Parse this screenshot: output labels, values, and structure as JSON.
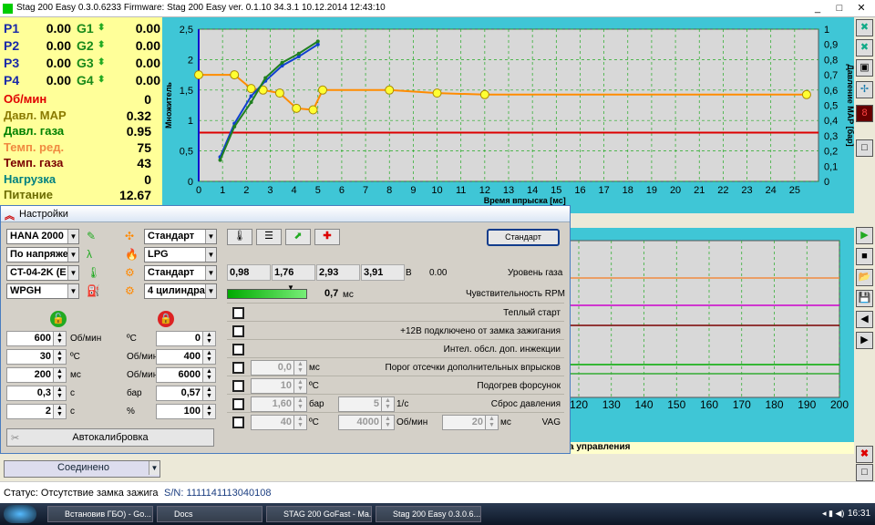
{
  "window": {
    "title": "Stag 200 Easy 0.3.0.6233 Firmware: Stag 200 Easy  ver. 0.1.10  34.3.1  10.12.2014 12:43:10",
    "min": "_",
    "max": "□",
    "close": "✕"
  },
  "injectors": [
    {
      "p": "P1",
      "pv": "0.00",
      "g": "G1",
      "gv": "0.00"
    },
    {
      "p": "P2",
      "pv": "0.00",
      "g": "G2",
      "gv": "0.00"
    },
    {
      "p": "P3",
      "pv": "0.00",
      "g": "G3",
      "gv": "0.00"
    },
    {
      "p": "P4",
      "pv": "0.00",
      "g": "G4",
      "gv": "0.00"
    }
  ],
  "params": [
    {
      "label": "Об/мин",
      "value": "0",
      "color": "#e00000"
    },
    {
      "label": "Давл. MAP",
      "value": "0.32",
      "color": "#8a7a00"
    },
    {
      "label": "Давл. газа",
      "value": "0.95",
      "color": "#008000"
    },
    {
      "label": "Темп. ред.",
      "value": "75",
      "color": "#f08a40"
    },
    {
      "label": "Темп. газа",
      "value": "43",
      "color": "#7a0000"
    },
    {
      "label": "Нагрузка",
      "value": "0",
      "color": "#008080"
    },
    {
      "label": "Питание",
      "value": "12.67",
      "color": "#6b6b00"
    }
  ],
  "chart_data": [
    {
      "type": "line",
      "ylabel": "Множитель",
      "y2label": "Давление MAP [бар]",
      "xlabel": "Время впрыска [мс]",
      "xlim": [
        0,
        26
      ],
      "ylim": [
        0,
        2.5
      ],
      "y2lim": [
        0,
        1
      ],
      "xticks": [
        "0",
        "1",
        "2",
        "3",
        "4",
        "5",
        "6",
        "7",
        "8",
        "9",
        "10",
        "11",
        "12",
        "13",
        "14",
        "15",
        "16",
        "17",
        "18",
        "19",
        "20",
        "21",
        "22",
        "23",
        "24",
        "25"
      ],
      "yticks": [
        "0",
        "0,5",
        "1",
        "1,5",
        "2",
        "2,5"
      ],
      "y2ticks": [
        "0",
        "0,1",
        "0,2",
        "0,3",
        "0,4",
        "0,5",
        "0,6",
        "0,7",
        "0,8",
        "0,9",
        "1"
      ],
      "series": [
        {
          "color": "#ff8c00",
          "x": [
            0,
            1.5,
            2.2,
            2.7,
            3.4,
            4.1,
            4.8,
            5.2,
            8,
            10,
            12,
            25.5
          ],
          "y": [
            0.7,
            0.7,
            0.61,
            0.6,
            0.58,
            0.48,
            0.47,
            0.6,
            0.6,
            0.58,
            0.57,
            0.57
          ],
          "axis": "y2"
        },
        {
          "color": "#1040d0",
          "x": [
            0.9,
            1.5,
            2.2,
            2.8,
            3.5,
            4.2,
            5
          ],
          "y": [
            0.4,
            0.95,
            1.4,
            1.65,
            1.9,
            2.05,
            2.25
          ],
          "axis": "y"
        },
        {
          "color": "#208020",
          "x": [
            0.9,
            1.5,
            2.2,
            2.8,
            3.5,
            4.2,
            5
          ],
          "y": [
            0.35,
            0.9,
            1.3,
            1.7,
            1.95,
            2.1,
            2.3
          ],
          "axis": "y"
        }
      ],
      "map_line": 0.32
    },
    {
      "type": "line",
      "xlim": [
        0,
        200
      ],
      "xticks": [
        "120",
        "130",
        "140",
        "150",
        "160",
        "170",
        "180",
        "190",
        "200"
      ]
    }
  ],
  "chart2_caption": "а управления",
  "dialog": {
    "title": "Настройки",
    "combos_left": [
      "HANA 2000",
      "По напряже",
      "CT-04-2K (E",
      "WPGH"
    ],
    "combos_right": [
      "Стандарт",
      "LPG",
      "Стандарт",
      "4 цилиндра"
    ],
    "cutoff_rows": [
      {
        "on": "600",
        "on_unit": "Об/мин",
        "off": "0",
        "off_unit": "ºC"
      },
      {
        "on": "30",
        "on_unit": "ºC",
        "off": "400",
        "off_unit": "Об/мин"
      },
      {
        "on": "200",
        "on_unit": "мс",
        "off": "6000",
        "off_unit": "Об/мин"
      },
      {
        "on": "0,3",
        "on_unit": "с",
        "off": "0,57",
        "off_unit": "бар"
      },
      {
        "on": "2",
        "on_unit": "с",
        "off": "100",
        "off_unit": "%"
      }
    ],
    "autocal": "Автокалибровка",
    "connected": "Соединено",
    "std_button": "Стандарт",
    "gas_levels": [
      "0,98",
      "1,76",
      "2,93",
      "3,91"
    ],
    "gas_unit": "В",
    "gas_value": "0.00",
    "gas_label": "Уровень газа",
    "rpm_value": "0,7",
    "rpm_unit": "мс",
    "rpm_label": "Чувствительность RPM",
    "checks": [
      {
        "label": "Теплый старт"
      },
      {
        "label": "+12В подключено от замка зажигания"
      },
      {
        "label": "Интел. обсл. доп. инжекции"
      },
      {
        "label": "Порог отсечки дополнительных впрысков",
        "v1": "0,0",
        "u1": "мс"
      },
      {
        "label": "Подогрев форсунок",
        "v1": "10",
        "u1": "ºC"
      },
      {
        "label": "Сброс давления",
        "v1": "1,60",
        "u1": "бар",
        "v2": "5",
        "u2": "1/с"
      },
      {
        "label": "VAG",
        "v1": "40",
        "u1": "ºC",
        "v2": "4000",
        "u2": "Об/мин",
        "v3": "20",
        "u3": "мс"
      }
    ]
  },
  "status": {
    "text": "Статус: Отсутствие замка зажига",
    "sn": "S/N: 1111141113040108"
  },
  "taskbar": {
    "tasks": [
      "Встановив ГБО) - Go...",
      "Docs",
      "STAG 200 GoFast - Ma...",
      "Stag 200 Easy 0.3.0.6..."
    ],
    "clock": "16:31"
  }
}
